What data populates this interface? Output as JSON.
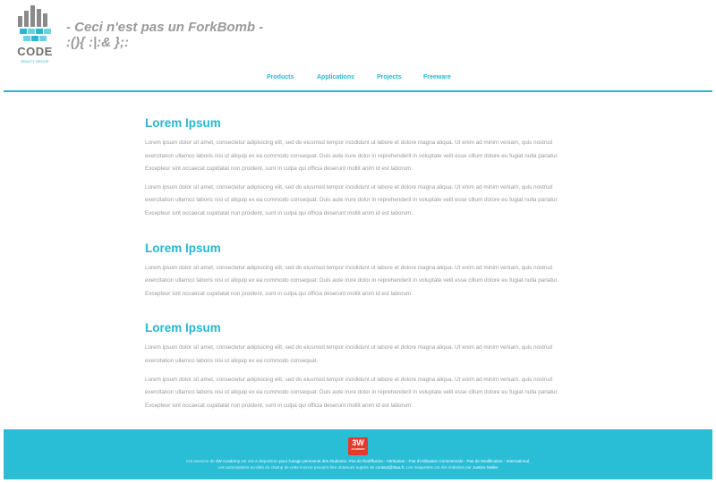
{
  "logo": {
    "word": "CODE",
    "sub": "REALTY GROUP"
  },
  "tagline": {
    "line1": "- Ceci n'est pas un ForkBomb -",
    "line2": ":(){ :|:& };:"
  },
  "nav": [
    "Products",
    "Applications",
    "Projects",
    "Freeware"
  ],
  "sections": [
    {
      "title": "Lorem Ipsum",
      "paragraphs": [
        "Lorem ipsum dolor sit amet, consectetur adipisicing elit, sed do eiusmod tempor incididunt ut labore et dolore magna aliqua. Ut enim ad minim veniam, quis nostrud exercitation ullamco laboris nisi ut aliquip ex ea commodo consequat. Duis aute irure dolor in reprehenderit in voluptate velit esse cillum dolore eu fugiat nulla pariatur. Excepteur sint occaecat cupidatat non proident, sunt in culpa qui officia deserunt mollit anim id est laborum.",
        "Lorem ipsum dolor sit amet, consectetur adipisicing elit, sed do eiusmod tempor incididunt ut labore et dolore magna aliqua. Ut enim ad minim veniam, quis nostrud exercitation ullamco laboris nisi ut aliquip ex ea commodo consequat. Duis aute irure dolor in reprehenderit in voluptate velit esse cillum dolore eu fugiat nulla pariatur. Excepteur sint occaecat cupidatat non proident, sunt in culpa qui officia deserunt mollit anim id est laborum."
      ]
    },
    {
      "title": "Lorem Ipsum",
      "paragraphs": [
        "Lorem ipsum dolor sit amet, consectetur adipisicing elit, sed do eiusmod tempor incididunt ut labore et dolore magna aliqua. Ut enim ad minim veniam, quis nostrud exercitation ullamco laboris nisi ut aliquip ex ea commodo consequat. Duis aute irure dolor in reprehenderit in voluptate velit esse cillum dolore eu fugiat nulla pariatur. Excepteur sint occaecat cupidatat non proident, sunt in culpa qui officia deserunt mollit anim id est laborum."
      ]
    },
    {
      "title": "Lorem Ipsum",
      "paragraphs": [
        "Lorem ipsum dolor sit amet, consectetur adipisicing elit, sed do eiusmod tempor incididunt ut labore et dolore magna aliqua. Ut enim ad minim veniam, quis nostrud exercitation ullamco laboris nisi ut aliquip ex ea commodo consequat.",
        "Lorem ipsum dolor sit amet, consectetur adipisicing elit, sed do eiusmod tempor incididunt ut labore et dolore magna aliqua. Ut enim ad minim veniam, quis nostrud exercitation ullamco laboris nisi ut aliquip ex ea commodo consequat. Duis aute irure dolor in reprehenderit in voluptate velit esse cillum dolore eu fugiat nulla pariatur. Excepteur sint occaecat cupidatat non proident, sunt in culpa qui officia deserunt mollit anim id est laborum."
      ]
    }
  ],
  "footer": {
    "logo_text": "3W",
    "logo_sub": "ACADEMY",
    "line1_a": "Cet exercice de",
    "line1_link1": "3W Academy",
    "line1_b": "est mis à disposition",
    "line1_c": "pour l'usage personnel des étudiants. Pas de Rediffusion - Attribution - Pas d'Utilisation Commerciale - Pas de Modification - International.",
    "line2_a": "Les autorisations au-delà du champ de cette licence peuvent être obtenues auprès de",
    "line2_email": "contact@3wa.fr",
    "line2_b": ". Les maquettes ont été réalisées par",
    "line2_author": "Justine Muller"
  },
  "colors": {
    "accent": "#29b6d1",
    "footer_bg": "#29bdd6",
    "text_gray": "#9a9a9a",
    "logo_red": "#e53a2b"
  },
  "icons": {
    "logo": "code-realty-group-logo",
    "footer_logo": "3w-academy-logo"
  }
}
